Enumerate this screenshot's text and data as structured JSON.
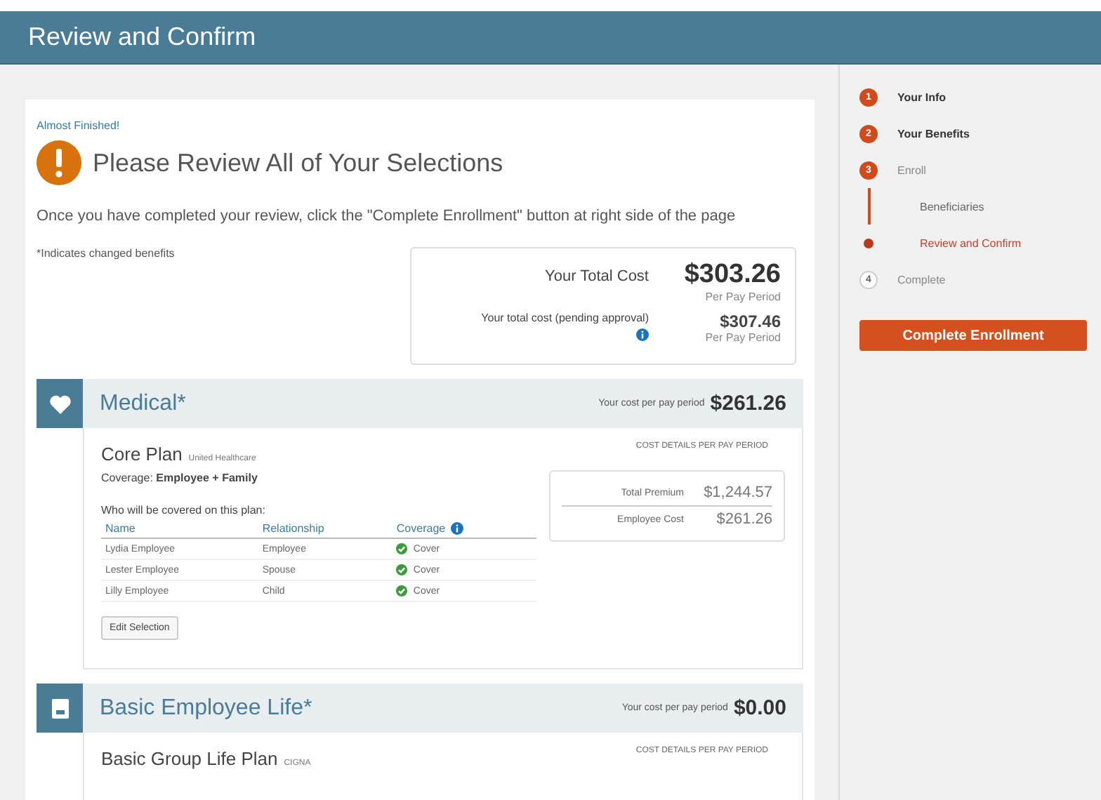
{
  "header": {
    "title": "Review and Confirm"
  },
  "review": {
    "eyebrow": "Almost Finished!",
    "heading": "Please Review All of Your Selections",
    "instructions": "Once you have completed your review, click the \"Complete Enrollment\" button at right side of the page",
    "note": "*Indicates changed benefits"
  },
  "totals": [
    {
      "label": "Your Total Cost",
      "amount": "$303.26",
      "period": "Per Pay Period",
      "info": false
    },
    {
      "label": "Your total cost (pending approval)",
      "amount": "$307.46",
      "period": "Per Pay Period",
      "info": true
    }
  ],
  "benefits": [
    {
      "kind": "medical",
      "title": "Medical*",
      "cost_label": "Your cost per pay period",
      "cost": "$261.26",
      "plan": "Core Plan",
      "carrier": "United Healthcare",
      "coverage_label": "Coverage:",
      "coverage": "Employee + Family",
      "covered_label": "Who will be covered on this plan:",
      "columns": [
        "Name",
        "Relationship",
        "Coverage"
      ],
      "rows": [
        {
          "name": "Lydia Employee",
          "relationship": "Employee",
          "coverage": "Cover",
          "covered": true
        },
        {
          "name": "Lester Employee",
          "relationship": "Spouse",
          "coverage": "Cover",
          "covered": true
        },
        {
          "name": "Lilly Employee",
          "relationship": "Child",
          "coverage": "Cover",
          "covered": true
        }
      ],
      "edit_button": "Edit Selection",
      "details_label": "COST DETAILS PER PAY PERIOD",
      "details": [
        {
          "label": "Total Premium",
          "value": "$1,244.57"
        },
        {
          "label": "Employee Cost",
          "value": "$261.26"
        }
      ]
    },
    {
      "kind": "life",
      "title": "Basic Employee Life*",
      "cost_label": "Your cost per pay period",
      "cost": "$0.00",
      "plan": "Basic Group Life Plan",
      "carrier": "CIGNA",
      "details_label": "COST DETAILS PER PAY PERIOD"
    }
  ],
  "steps": [
    {
      "kind": "step",
      "number": "1",
      "label": "Your Info",
      "reached": true,
      "bold": true
    },
    {
      "kind": "step",
      "number": "2",
      "label": "Your Benefits",
      "reached": true,
      "bold": true
    },
    {
      "kind": "step",
      "number": "3",
      "label": "Enroll",
      "reached": true,
      "bold": false
    },
    {
      "kind": "substep",
      "label": "Beneficiaries",
      "selected": false
    },
    {
      "kind": "substep",
      "label": "Review and Confirm",
      "selected": true
    },
    {
      "kind": "step",
      "number": "4",
      "label": "Complete",
      "reached": false,
      "bold": false
    }
  ],
  "complete_button": "Complete Enrollment"
}
